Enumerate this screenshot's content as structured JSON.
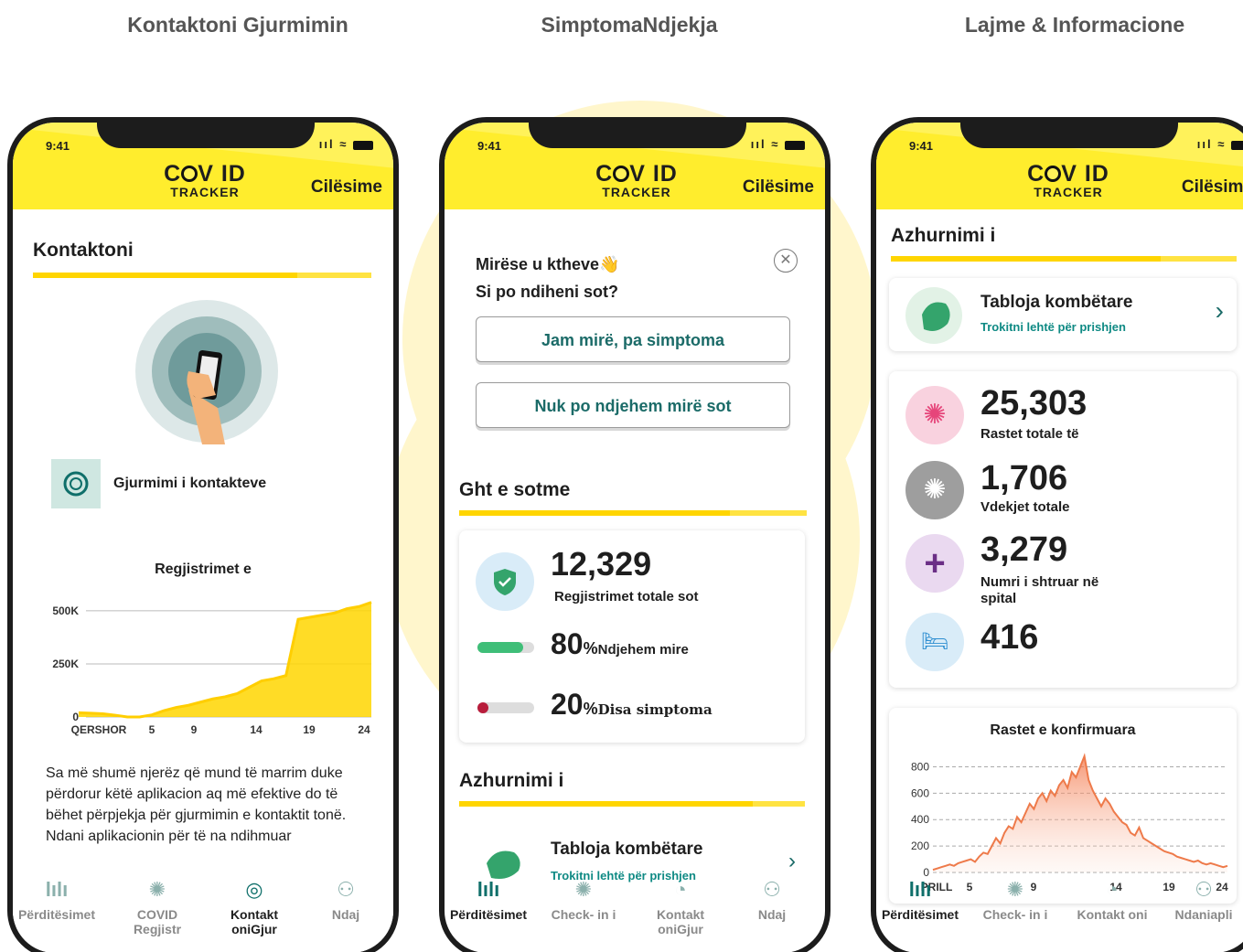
{
  "sections": {
    "left_title": "Kontaktoni Gjurmimin",
    "middle_title": "SimptomaNdjekja",
    "right_title": "Lajme & Informacione"
  },
  "phone_common": {
    "time": "9:41",
    "time_right": "9:41",
    "logo_top": "COV ID",
    "logo_bottom": "TRACKER",
    "settings_label": "Cilësime",
    "status_glyphs": "ııl ≈"
  },
  "phone1": {
    "heading": "Kontaktoni",
    "contact_item_label": "Gjurmimi i kontakteve",
    "chart_title": "Regjistrimet e",
    "chart_data": {
      "type": "area",
      "title": "Regjistrimet e",
      "x_ticks": [
        "QERSHOR",
        "5",
        "9",
        "14",
        "19",
        "24"
      ],
      "y_ticks": [
        "0",
        "250K",
        "500K"
      ],
      "ylim": [
        0,
        560000
      ],
      "x": [
        1,
        2,
        3,
        4,
        5,
        6,
        7,
        8,
        9,
        10,
        11,
        12,
        13,
        14,
        15,
        16,
        17,
        18,
        19,
        20,
        21,
        22,
        23,
        24,
        25
      ],
      "values": [
        20000,
        18000,
        15000,
        8000,
        0,
        0,
        10000,
        30000,
        45000,
        55000,
        70000,
        85000,
        95000,
        110000,
        140000,
        170000,
        180000,
        195000,
        460000,
        470000,
        480000,
        490000,
        510000,
        520000,
        540000
      ],
      "color": "#ffd600"
    },
    "body_text": "Sa më shumë njerëz që mund të marrim duke përdorur këtë aplikacion aq më efektive do të bëhet përpjekja për gjurmimin e kontaktit tonë. Ndani aplikacionin për të na ndihmuar",
    "tabs": [
      {
        "label": "Përditësimet",
        "icon": "bar-chart-icon"
      },
      {
        "label": "COVID Regjistr",
        "icon": "virus-icon"
      },
      {
        "label": "Kontakt oniGjur",
        "icon": "contact-tracing-icon"
      },
      {
        "label": "Ndaj",
        "icon": "people-icon"
      }
    ]
  },
  "phone2": {
    "welcome_line1": "Mirëse u ktheve",
    "welcome_emoji": "👋",
    "welcome_line2": "Si po ndiheni sot?",
    "btn_ok": "Jam mirë, pa simptoma",
    "btn_not_ok": "Nuk po ndjehem mirë sot",
    "today_heading": "Ght e sotme",
    "total_value": "12,329",
    "total_label": "Regjistrimet totale sot",
    "well_pct": "80",
    "well_label": "Ndjehem mire",
    "well_fraction": 0.8,
    "symptoms_pct": "20",
    "symptoms_label": "Disa simptoma",
    "symptoms_fraction": 0.2,
    "pct_sign": "%",
    "update_heading": "Azhurnimi i",
    "dashboard_title": "Tabloja kombëtare",
    "dashboard_sub": "Trokitni lehtë për prishjen",
    "chevron": "›",
    "tabs": [
      {
        "label": "Përditësimet",
        "icon": "bar-chart-icon"
      },
      {
        "label": "Check- in i",
        "icon": "virus-icon"
      },
      {
        "label": "Kontakt oniGjur",
        "icon": "contact-tracing-icon"
      },
      {
        "label": "Ndaj",
        "icon": "people-icon"
      }
    ]
  },
  "phone3": {
    "update_heading": "Azhurnimi i",
    "dashboard_title": "Tabloja kombëtare",
    "dashboard_sub": "Trokitni lehtë për prishjen",
    "chevron": "›",
    "stats": [
      {
        "value": "25,303",
        "label": "Rastet totale të",
        "icon": "virus-icon",
        "color": "#e6457a",
        "bg": "#f9d2df"
      },
      {
        "value": "1,706",
        "label": "Vdekjet totale",
        "icon": "virus-gray-icon",
        "color": "#ffffff",
        "bg": "#9e9e9e"
      },
      {
        "value": "3,279",
        "label": "Numri i shtruar në spital",
        "icon": "hospital-cross-icon",
        "color": "#6b2f86",
        "bg": "#ead9f0"
      },
      {
        "value": "416",
        "label": "",
        "icon": "bed-icon",
        "color": "#2f8fd1",
        "bg": "#d9ecf8"
      }
    ],
    "chart_title": "Rastet e konfirmuara",
    "chart_data": {
      "type": "area",
      "title": "Rastet e konfirmuara",
      "x_ticks": [
        "PRILL",
        "5",
        "9",
        "14",
        "19",
        "24"
      ],
      "y_ticks": [
        "0",
        "200",
        "400",
        "600",
        "800"
      ],
      "ylim": [
        0,
        900
      ],
      "values": [
        20,
        30,
        40,
        50,
        60,
        50,
        70,
        80,
        90,
        100,
        80,
        120,
        150,
        140,
        200,
        260,
        220,
        300,
        350,
        330,
        420,
        380,
        450,
        520,
        480,
        560,
        600,
        540,
        620,
        580,
        660,
        700,
        640,
        760,
        720,
        800,
        880,
        700,
        620,
        560,
        500,
        560,
        520,
        460,
        420,
        380,
        360,
        300,
        280,
        340,
        260,
        240,
        220,
        200,
        180,
        160,
        150,
        140,
        120,
        110,
        100,
        90,
        80,
        90,
        70,
        60,
        70,
        60,
        50,
        40,
        50
      ],
      "color": "#ee7a4a"
    },
    "tabs": [
      {
        "label": "Përditësimet",
        "icon": "bar-chart-icon"
      },
      {
        "label": "Check- in i",
        "icon": "virus-icon"
      },
      {
        "label": "Kontakt oni",
        "icon": "contact-tracing-icon"
      },
      {
        "label": "Ndaniapli",
        "icon": "people-icon"
      }
    ]
  }
}
